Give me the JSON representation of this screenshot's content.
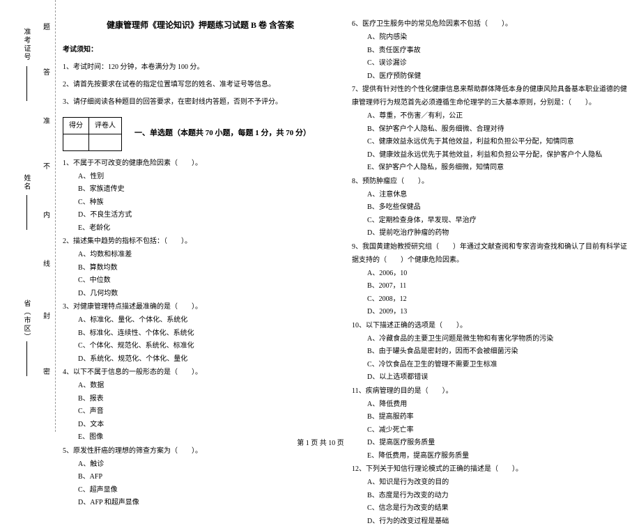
{
  "title": "健康管理师《理论知识》押题练习试题 B 卷  含答案",
  "noticeHeader": "考试须知：",
  "notices": [
    "1、考试时间：120 分钟，本卷满分为 100 分。",
    "2、请首先按要求在试卷的指定位置填写您的姓名、准考证号等信息。",
    "3、请仔细阅读各种题目的回答要求，在密封线内答题，否则不予评分。"
  ],
  "scoreHeader1": "得分",
  "scoreHeader2": "评卷人",
  "partTitle": "一、单选题（本题共 70 小题，每题 1 分，共 70 分）",
  "sideLabels": {
    "province": "省（市区）",
    "name": "姓名",
    "admission": "准考证号",
    "seal": "密",
    "feng": "封",
    "xian": "线",
    "nei": "内",
    "bu": "不",
    "zhun": "准",
    "da": "答",
    "ti": "题"
  },
  "leftQuestions": [
    {
      "q": "1、不属于不可改变的健康危险因素（　　）。",
      "opts": [
        "A、性别",
        "B、家族遗传史",
        "C、种族",
        "D、不良生活方式",
        "E、老龄化"
      ]
    },
    {
      "q": "2、描述集中趋势的指标不包括：（　　）。",
      "opts": [
        "A、均数和标准差",
        "B、算数均数",
        "C、中位数",
        "D、几何均数"
      ]
    },
    {
      "q": "3、对健康管理特点描述最准确的是（　　）。",
      "opts": [
        "A、标准化、量化、个体化、系统化",
        "B、标准化、连续性、个体化、系统化",
        "C、个体化、规范化、系统化、标准化",
        "D、系统化、规范化、个体化、量化"
      ]
    },
    {
      "q": "4、以下不属于信息的一般形态的是（　　）。",
      "opts": [
        "A、数据",
        "B、报表",
        "C、声音",
        "D、文本",
        "E、图像"
      ]
    },
    {
      "q": "5、原发性肝癌的理想的筛查方案为（　　）。",
      "opts": [
        "A、触诊",
        "B、AFP",
        "C、超声显像",
        "D、AFP 和超声显像"
      ]
    }
  ],
  "rightQuestions": [
    {
      "q": "6、医疗卫生服务中的常见危险因素不包括（　　）。",
      "opts": [
        "A、院内感染",
        "B、责任医疗事故",
        "C、误诊漏诊",
        "D、医疗预防保健"
      ]
    },
    {
      "q": "7、提供有针对性的个性化健康信息来帮助群体降低本身的健康风险具备基本职业道德的健康管理师行为规范首先必须遵循生命伦理学的三大基本原则，分别是：（　　）。",
      "opts": [
        "A、尊重，不伤害／有利，公正",
        "B、保护客户个人隐私、服务细微、合理对待",
        "C、健康效益永远优先于其他效益，利益和负担公平分配，知情同意",
        "D、健康效益永远优先于其他效益，利益和负担公平分配，保护客户个人隐私",
        "E、保护客户个人隐私，服务细微，知情同意"
      ]
    },
    {
      "q": "8、预防肿瘤应（　　）。",
      "opts": [
        "A、注意休息",
        "B、多吃些保健品",
        "C、定期检查身体，早发现、早治疗",
        "D、提前吃治疗肿瘤的药物"
      ]
    },
    {
      "q": "9、我国黄建始教授研究组（　　）年通过文献查阅和专家咨询查找和确认了目前有科学证据支持的（　　）个健康危险因素。",
      "opts": [
        "A、2006，10",
        "B、2007，11",
        "C、2008，12",
        "D、2009，13"
      ]
    },
    {
      "q": "10、以下描述正确的选项是（　　）。",
      "opts": [
        "A、冷藏食品的主要卫生问题是微生物和有害化学物质的污染",
        "B、由于罐头食品是密封的，因而不会被细菌污染",
        "C、冷饮食品在卫生的管理不需要卫生标准",
        "D、以上选项都错误"
      ]
    },
    {
      "q": "11、疾病管理的目的是（　　）。",
      "opts": [
        "A、降低费用",
        "B、提高服药率",
        "C、减少死亡率",
        "D、提高医疗服务质量",
        "E、降低费用，提高医疗服务质量"
      ]
    },
    {
      "q": "12、下列关于知信行理论模式的正确的描述是（　　）。",
      "opts": [
        "A、知识是行为改变的目的",
        "B、态度是行为改变的动力",
        "C、信念是行为改变的结果",
        "D、行为的改变过程是基础"
      ]
    }
  ],
  "footer": "第 1 页 共 10 页"
}
